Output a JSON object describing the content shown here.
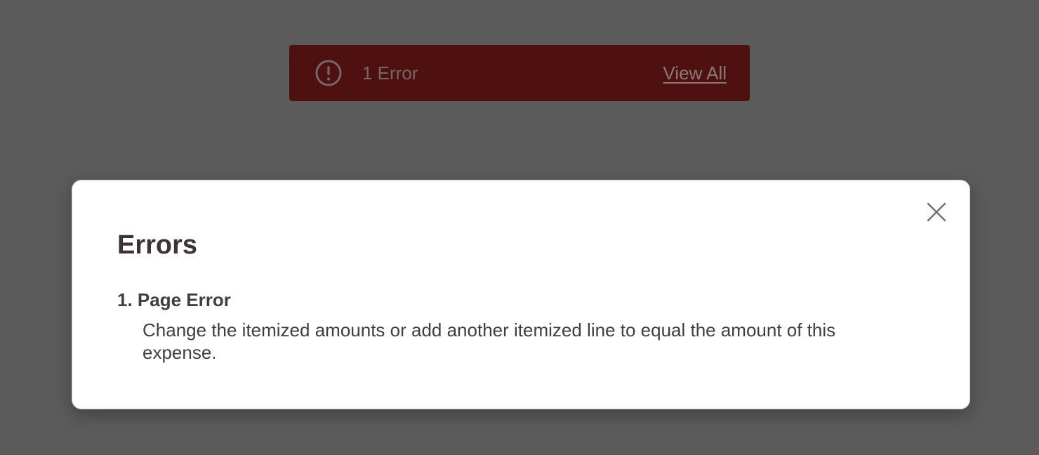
{
  "banner": {
    "count_label": "1 Error",
    "view_all_label": "View All",
    "icon": "exclamation-circle-icon",
    "background_color": "#4f1010"
  },
  "modal": {
    "title": "Errors",
    "close_icon": "close-icon",
    "errors": [
      {
        "title": "1. Page Error",
        "message": "Change the itemized amounts or add another itemized line to equal the amount of this expense."
      }
    ]
  },
  "colors": {
    "overlay": "#5b5b5b",
    "modal_background": "#ffffff",
    "title_text": "#3e3234",
    "body_text": "#3f3f3f"
  }
}
